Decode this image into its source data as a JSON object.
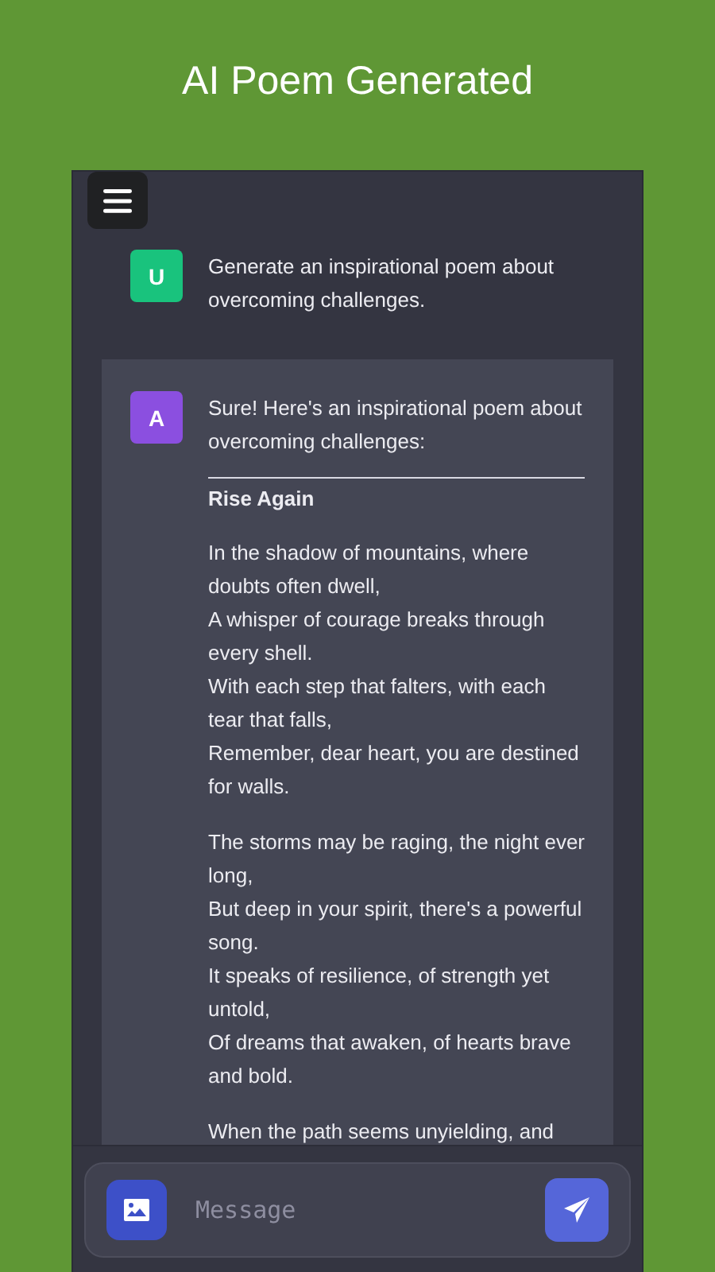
{
  "header": {
    "title": "AI Poem Generated"
  },
  "messages": [
    {
      "kind": "user",
      "avatar": "U",
      "color": "#19c37d",
      "intro": "Generate an inspirational poem about overcoming challenges."
    },
    {
      "kind": "assistant",
      "avatar": "A",
      "color": "#8b4fe0",
      "intro": "Sure! Here's an inspirational poem about overcoming challenges:",
      "poem_title": "Rise Again",
      "stanzas": [
        [
          "In the shadow of mountains, where doubts often dwell,",
          "A whisper of courage breaks through every shell.",
          "With each step that falters, with each tear that falls,",
          "Remember, dear heart, you are destined for walls."
        ],
        [
          "The storms may be raging, the night ever long,",
          "But deep in your spirit, there's a powerful song.",
          "It speaks of resilience, of strength yet untold,",
          "Of dreams that awaken, of hearts brave and bold."
        ],
        [
          "When the path seems unyielding, and"
        ]
      ]
    }
  ],
  "composer": {
    "placeholder": "Message"
  }
}
